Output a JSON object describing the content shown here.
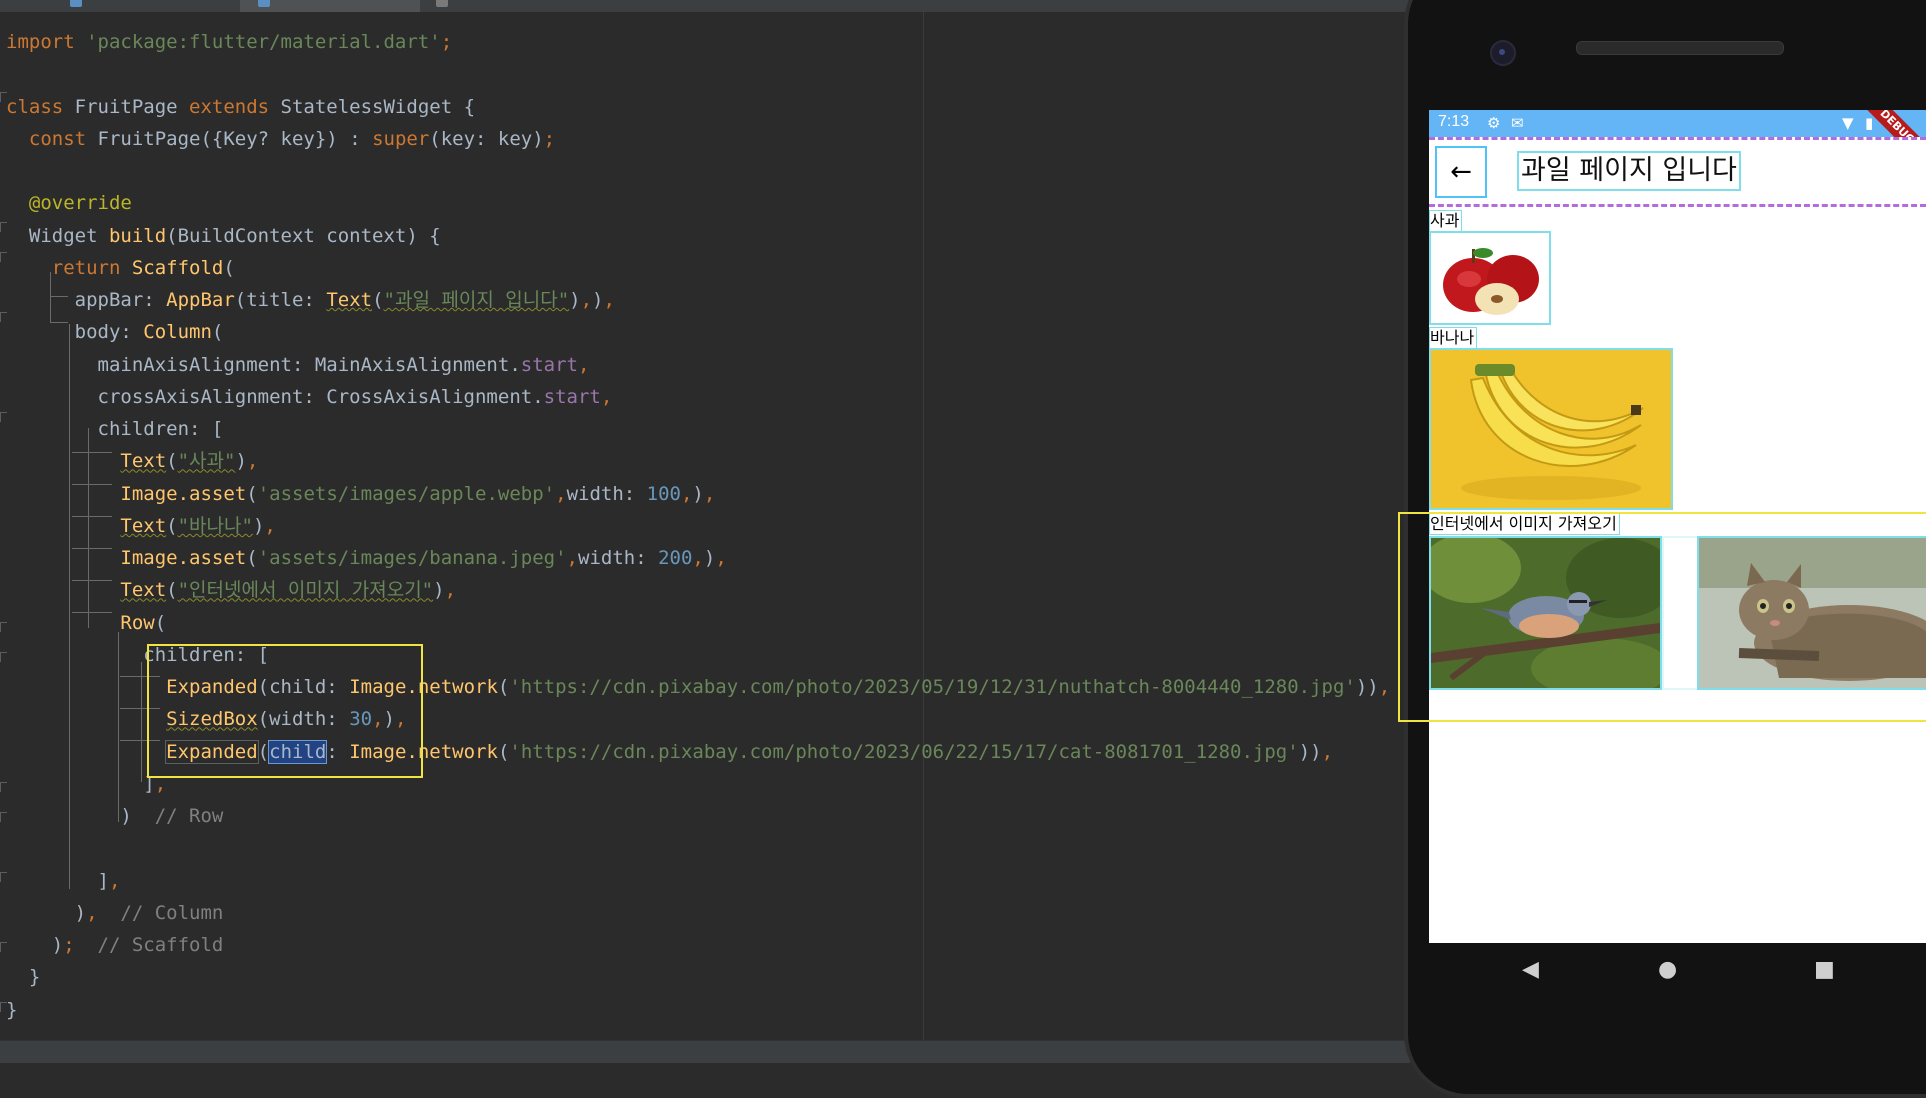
{
  "editor": {
    "lines": [
      {
        "parts": [
          [
            "kw",
            "import "
          ],
          [
            "str",
            "'package:flutter/material.dart'"
          ],
          [
            "kw",
            ";"
          ]
        ]
      },
      {
        "parts": []
      },
      {
        "parts": [
          [
            "kw",
            "class "
          ],
          [
            "p",
            "FruitPage "
          ],
          [
            "kw",
            "extends "
          ],
          [
            "p",
            "StatelessWidget {"
          ]
        ]
      },
      {
        "parts": [
          [
            "p",
            "  "
          ],
          [
            "kw",
            "const "
          ],
          [
            "p",
            "FruitPage({Key? key}) : "
          ],
          [
            "kw",
            "super"
          ],
          [
            "p",
            "(key: key)"
          ],
          [
            "kw",
            ";"
          ]
        ]
      },
      {
        "parts": []
      },
      {
        "parts": [
          [
            "p",
            "  "
          ],
          [
            "ann",
            "@override"
          ]
        ]
      },
      {
        "parts": [
          [
            "p",
            "  Widget "
          ],
          [
            "fn",
            "build"
          ],
          [
            "p",
            "(BuildContext context) {"
          ]
        ]
      },
      {
        "parts": [
          [
            "p",
            "    "
          ],
          [
            "kw",
            "return "
          ],
          [
            "fn",
            "Scaffold"
          ],
          [
            "p",
            "("
          ]
        ]
      },
      {
        "parts": [
          [
            "p",
            "      appBar: "
          ],
          [
            "fn",
            "AppBar"
          ],
          [
            "p",
            "(title: "
          ],
          [
            "fnw",
            "Text"
          ],
          [
            "p",
            "("
          ],
          [
            "strw",
            "\"과일 페이지 입니다\""
          ],
          [
            "p",
            ")"
          ],
          [
            "kw",
            ","
          ],
          [
            "p",
            ")"
          ],
          [
            "kw",
            ","
          ]
        ]
      },
      {
        "parts": [
          [
            "p",
            "      body: "
          ],
          [
            "fn",
            "Column"
          ],
          [
            "p",
            "("
          ]
        ]
      },
      {
        "parts": [
          [
            "p",
            "        mainAxisAlignment: MainAxisAlignment."
          ],
          [
            "cst",
            "start"
          ],
          [
            "kw",
            ","
          ]
        ]
      },
      {
        "parts": [
          [
            "p",
            "        crossAxisAlignment: CrossAxisAlignment."
          ],
          [
            "cst",
            "start"
          ],
          [
            "kw",
            ","
          ]
        ]
      },
      {
        "parts": [
          [
            "p",
            "        children: ["
          ]
        ]
      },
      {
        "parts": [
          [
            "p",
            "          "
          ],
          [
            "fnw",
            "Text"
          ],
          [
            "p",
            "("
          ],
          [
            "strw",
            "\"사과\""
          ],
          [
            "p",
            ")"
          ],
          [
            "kw",
            ","
          ]
        ]
      },
      {
        "parts": [
          [
            "p",
            "          "
          ],
          [
            "fn",
            "Image.asset"
          ],
          [
            "p",
            "("
          ],
          [
            "str",
            "'assets/images/apple.webp'"
          ],
          [
            "kw",
            ","
          ],
          [
            "p",
            "width: "
          ],
          [
            "num",
            "100"
          ],
          [
            "kw",
            ","
          ],
          [
            "p",
            ")"
          ],
          [
            "kw",
            ","
          ]
        ]
      },
      {
        "parts": [
          [
            "p",
            "          "
          ],
          [
            "fnw",
            "Text"
          ],
          [
            "p",
            "("
          ],
          [
            "strw",
            "\"바나나\""
          ],
          [
            "p",
            ")"
          ],
          [
            "kw",
            ","
          ]
        ]
      },
      {
        "parts": [
          [
            "p",
            "          "
          ],
          [
            "fn",
            "Image.asset"
          ],
          [
            "p",
            "("
          ],
          [
            "str",
            "'assets/images/banana.jpeg'"
          ],
          [
            "kw",
            ","
          ],
          [
            "p",
            "width: "
          ],
          [
            "num",
            "200"
          ],
          [
            "kw",
            ","
          ],
          [
            "p",
            ")"
          ],
          [
            "kw",
            ","
          ]
        ]
      },
      {
        "parts": [
          [
            "p",
            "          "
          ],
          [
            "fnw",
            "Text"
          ],
          [
            "p",
            "("
          ],
          [
            "strw",
            "\"인터넷에서 이미지 가져오기\""
          ],
          [
            "p",
            ")"
          ],
          [
            "kw",
            ","
          ]
        ]
      },
      {
        "parts": [
          [
            "p",
            "          "
          ],
          [
            "fn",
            "Row"
          ],
          [
            "p",
            "("
          ]
        ]
      },
      {
        "parts": [
          [
            "p",
            "            children: ["
          ]
        ]
      },
      {
        "parts": [
          [
            "p",
            "              "
          ],
          [
            "fn",
            "Expanded"
          ],
          [
            "p",
            "(child: "
          ],
          [
            "fn",
            "Image.network"
          ],
          [
            "p",
            "("
          ],
          [
            "str",
            "'https://cdn.pixabay.com/photo/2023/05/19/12/31/nuthatch-8004440_1280.jpg'"
          ],
          [
            "p",
            "))"
          ],
          [
            "kw",
            ","
          ]
        ]
      },
      {
        "parts": [
          [
            "p",
            "              "
          ],
          [
            "fnw",
            "SizedBox"
          ],
          [
            "p",
            "(width: "
          ],
          [
            "num",
            "30"
          ],
          [
            "kw",
            ","
          ],
          [
            "p",
            ")"
          ],
          [
            "kw",
            ","
          ]
        ]
      },
      {
        "parts": [
          [
            "p",
            "              "
          ],
          [
            "fnb",
            "Expanded"
          ],
          [
            "p",
            "("
          ],
          [
            "sel",
            "child"
          ],
          [
            "p",
            ": "
          ],
          [
            "fn",
            "Image.network"
          ],
          [
            "p",
            "("
          ],
          [
            "str",
            "'https://cdn.pixabay.com/photo/2023/06/22/15/17/cat-8081701_1280.jpg'"
          ],
          [
            "p",
            "))"
          ],
          [
            "kw",
            ","
          ]
        ]
      },
      {
        "parts": [
          [
            "p",
            "            ]"
          ],
          [
            "kw",
            ","
          ]
        ]
      },
      {
        "parts": [
          [
            "p",
            "          )  "
          ],
          [
            "cm",
            "// Row"
          ]
        ]
      },
      {
        "parts": []
      },
      {
        "parts": [
          [
            "p",
            "        ]"
          ],
          [
            "kw",
            ","
          ]
        ]
      },
      {
        "parts": [
          [
            "p",
            "      )"
          ],
          [
            "kw",
            ","
          ],
          [
            "p",
            "  "
          ],
          [
            "cm",
            "// Column"
          ]
        ]
      },
      {
        "parts": [
          [
            "p",
            "    )"
          ],
          [
            "kw",
            ";"
          ],
          [
            "p",
            "  "
          ],
          [
            "cm",
            "// Scaffold"
          ]
        ]
      },
      {
        "parts": [
          [
            "p",
            "  }"
          ]
        ]
      },
      {
        "parts": [
          [
            "p",
            "}"
          ]
        ]
      }
    ]
  },
  "phone": {
    "status_time": "7:13",
    "status_icons": [
      "settings-icon",
      "gmail-icon",
      "wifi-icon",
      "battery-icon"
    ],
    "debug_banner": "DEBUG",
    "appbar_title": "과일 페이지 입니다",
    "back_icon": "←",
    "texts": {
      "apple": "사과",
      "banana": "바나나",
      "internet": "인터넷에서 이미지 가져오기"
    },
    "nav": {
      "back": "◀",
      "home": "●",
      "recents": "■"
    }
  }
}
